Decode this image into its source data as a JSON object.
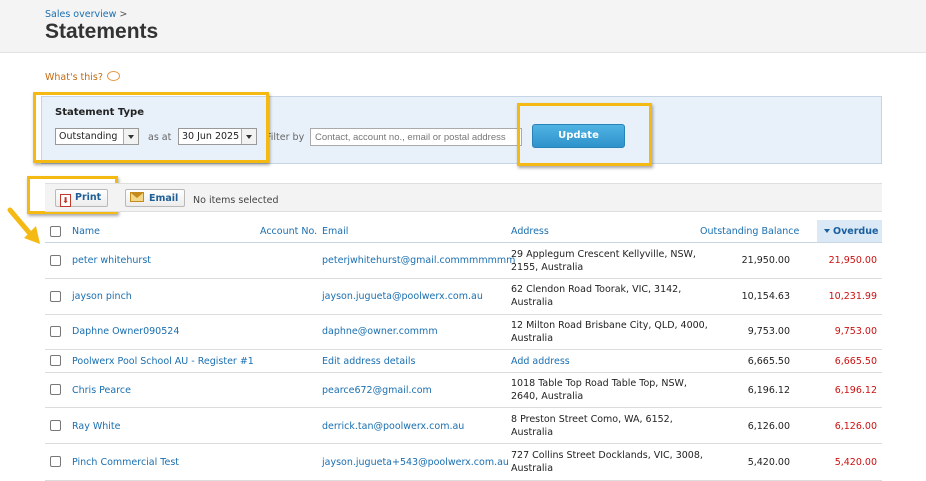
{
  "breadcrumb": {
    "label": "Sales overview",
    "separator": ">"
  },
  "page": {
    "title": "Statements"
  },
  "help": {
    "label": "What's this?"
  },
  "filter": {
    "type_label": "Statement Type",
    "type_value": "Outstanding",
    "as_at_label": "as at",
    "date_value": "30 Jun 2025",
    "filter_by_label": "Filter by",
    "search_placeholder": "Contact, account no., email or postal address",
    "update_label": "Update"
  },
  "toolbar": {
    "print_label": "Print",
    "email_label": "Email",
    "selection_status": "No items selected"
  },
  "table": {
    "headers": {
      "name": "Name",
      "account": "Account No.",
      "email": "Email",
      "address": "Address",
      "outstanding": "Outstanding Balance",
      "overdue": "Overdue"
    },
    "rows": [
      {
        "name": "peter whitehurst",
        "account": "",
        "email": "peterjwhitehurst@gmail.commmmmmm",
        "address_line1": "29 Applegum Crescent Kellyville, NSW,",
        "address_line2": "2155, Australia",
        "outstanding": "21,950.00",
        "overdue": "21,950.00"
      },
      {
        "name": "jayson pinch",
        "account": "",
        "email": "jayson.jugueta@poolwerx.com.au",
        "address_line1": "62 Clendon Road Toorak, VIC, 3142,",
        "address_line2": "Australia",
        "outstanding": "10,154.63",
        "overdue": "10,231.99"
      },
      {
        "name": "Daphne Owner090524",
        "account": "",
        "email": "daphne@owner.commm",
        "address_line1": "12 Milton Road Brisbane City, QLD, 4000,",
        "address_line2": "Australia",
        "outstanding": "9,753.00",
        "overdue": "9,753.00"
      },
      {
        "name": "Poolwerx Pool School AU - Register #1",
        "account": "",
        "email": "Edit address details",
        "address_line1": "Add address",
        "address_line2": "",
        "outstanding": "6,665.50",
        "overdue": "6,665.50"
      },
      {
        "name": "Chris Pearce",
        "account": "",
        "email": "pearce672@gmail.com",
        "address_line1": "1018 Table Top Road Table Top, NSW,",
        "address_line2": "2640, Australia",
        "outstanding": "6,196.12",
        "overdue": "6,196.12"
      },
      {
        "name": "Ray White",
        "account": "",
        "email": "derrick.tan@poolwerx.com.au",
        "address_line1": "8 Preston Street Como, WA, 6152,",
        "address_line2": "Australia",
        "outstanding": "6,126.00",
        "overdue": "6,126.00"
      },
      {
        "name": "Pinch Commercial Test",
        "account": "",
        "email": "jayson.jugueta+543@poolwerx.com.au",
        "address_line1": "727 Collins Street Docklands, VIC, 3008,",
        "address_line2": "Australia",
        "outstanding": "5,420.00",
        "overdue": "5,420.00"
      }
    ]
  },
  "colors": {
    "highlight": "#f5b914",
    "link": "#1a6fb0",
    "overdue": "#cc1111",
    "update_button": "#3aa3d8"
  }
}
